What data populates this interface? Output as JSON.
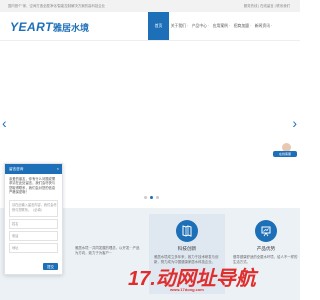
{
  "topbar": {
    "left_text": "国内首个“家、空间打造全屋净化/智能控制解决方案的高科技企业",
    "right_text": "服务热线 | 在线留言 | 联系我们"
  },
  "header": {
    "logo_en": "YEART",
    "logo_cn": "雅居水境",
    "brand_color": "#1d6fb8"
  },
  "nav": {
    "items": [
      {
        "label": "首页"
      },
      {
        "label": "关于我们 ·"
      },
      {
        "label": "产品中心 ·"
      },
      {
        "label": "应用案例 ·"
      },
      {
        "label": "招商加盟 ·"
      },
      {
        "label": "新闻资讯 ·"
      }
    ]
  },
  "hero": {
    "arrow_left": "‹",
    "arrow_right": "›",
    "slides": 3,
    "active_slide": 1
  },
  "service": {
    "badge": "在线客服"
  },
  "features": [
    {
      "title": "",
      "desc": "雅居水境···共同发展的理念，以开发···产品为方向，致力于为客户···"
    },
    {
      "title": "科技创新",
      "desc": "雅居水境成立多年来，致力于技术研发与创新，努力成为中国健康家居水科技企业。"
    },
    {
      "title": "产品优势",
      "desc": "倡导健康舒适的全屋水环境，给人不一样的生活方式。"
    }
  ],
  "chat": {
    "title": "留言咨询",
    "close": "×",
    "message": "亲爱的朋友，你有什么问题或需求请在此处留言，我们会尽快与您取得联系，我们会对您的信息严格保密哦！",
    "fields": [
      {
        "placeholder": "请在此输入留言内容，我们会尽快与您联系。（必填）"
      },
      {
        "placeholder": "姓名"
      },
      {
        "placeholder": "电话"
      },
      {
        "placeholder": "地址"
      }
    ],
    "submit": "提交"
  },
  "watermark": {
    "text": "17.动网址导航",
    "sub": "www.17dong.com"
  }
}
